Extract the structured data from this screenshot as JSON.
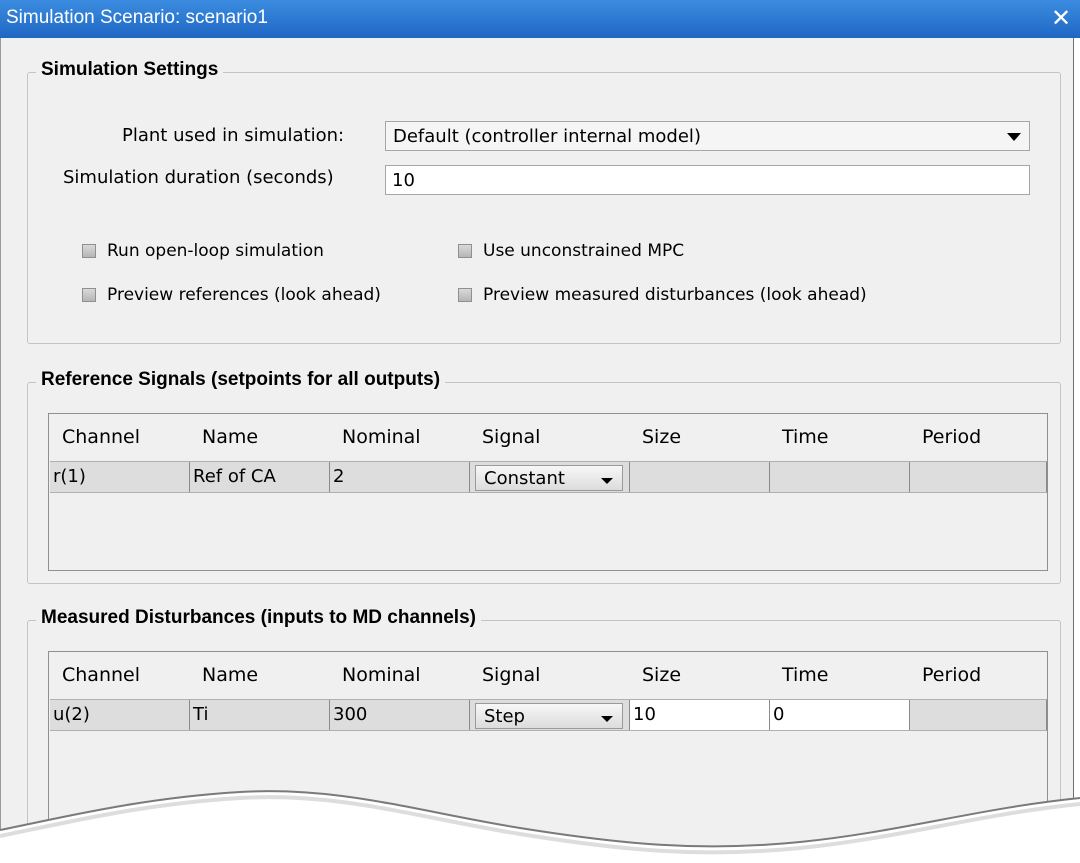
{
  "window": {
    "title": "Simulation Scenario: scenario1",
    "close_glyph": "✕"
  },
  "settings": {
    "group_title": "Simulation Settings",
    "plant_label": "Plant used in simulation:",
    "plant_value": "Default (controller internal model)",
    "duration_label": "Simulation duration (seconds)",
    "duration_value": "10",
    "checkboxes": [
      {
        "label": "Run open-loop simulation",
        "checked": false
      },
      {
        "label": "Use unconstrained MPC",
        "checked": false
      },
      {
        "label": "Preview references (look ahead)",
        "checked": false
      },
      {
        "label": "Preview measured disturbances (look ahead)",
        "checked": false
      }
    ]
  },
  "reference": {
    "group_title": "Reference Signals (setpoints for all outputs)",
    "headers": [
      "Channel",
      "Name",
      "Nominal",
      "Signal",
      "Size",
      "Time",
      "Period"
    ],
    "row": {
      "channel": "r(1)",
      "name": "Ref of CA",
      "nominal": "2",
      "signal": "Constant",
      "size": "",
      "time": "",
      "period": ""
    }
  },
  "disturbances": {
    "group_title": "Measured Disturbances (inputs to MD channels)",
    "headers": [
      "Channel",
      "Name",
      "Nominal",
      "Signal",
      "Size",
      "Time",
      "Period"
    ],
    "row": {
      "channel": "u(2)",
      "name": "Ti",
      "nominal": "300",
      "signal": "Step",
      "size": "10",
      "time": "0",
      "period": ""
    }
  },
  "colors": {
    "titlebar": "#2a77d4",
    "panel": "#f0f0f0"
  }
}
